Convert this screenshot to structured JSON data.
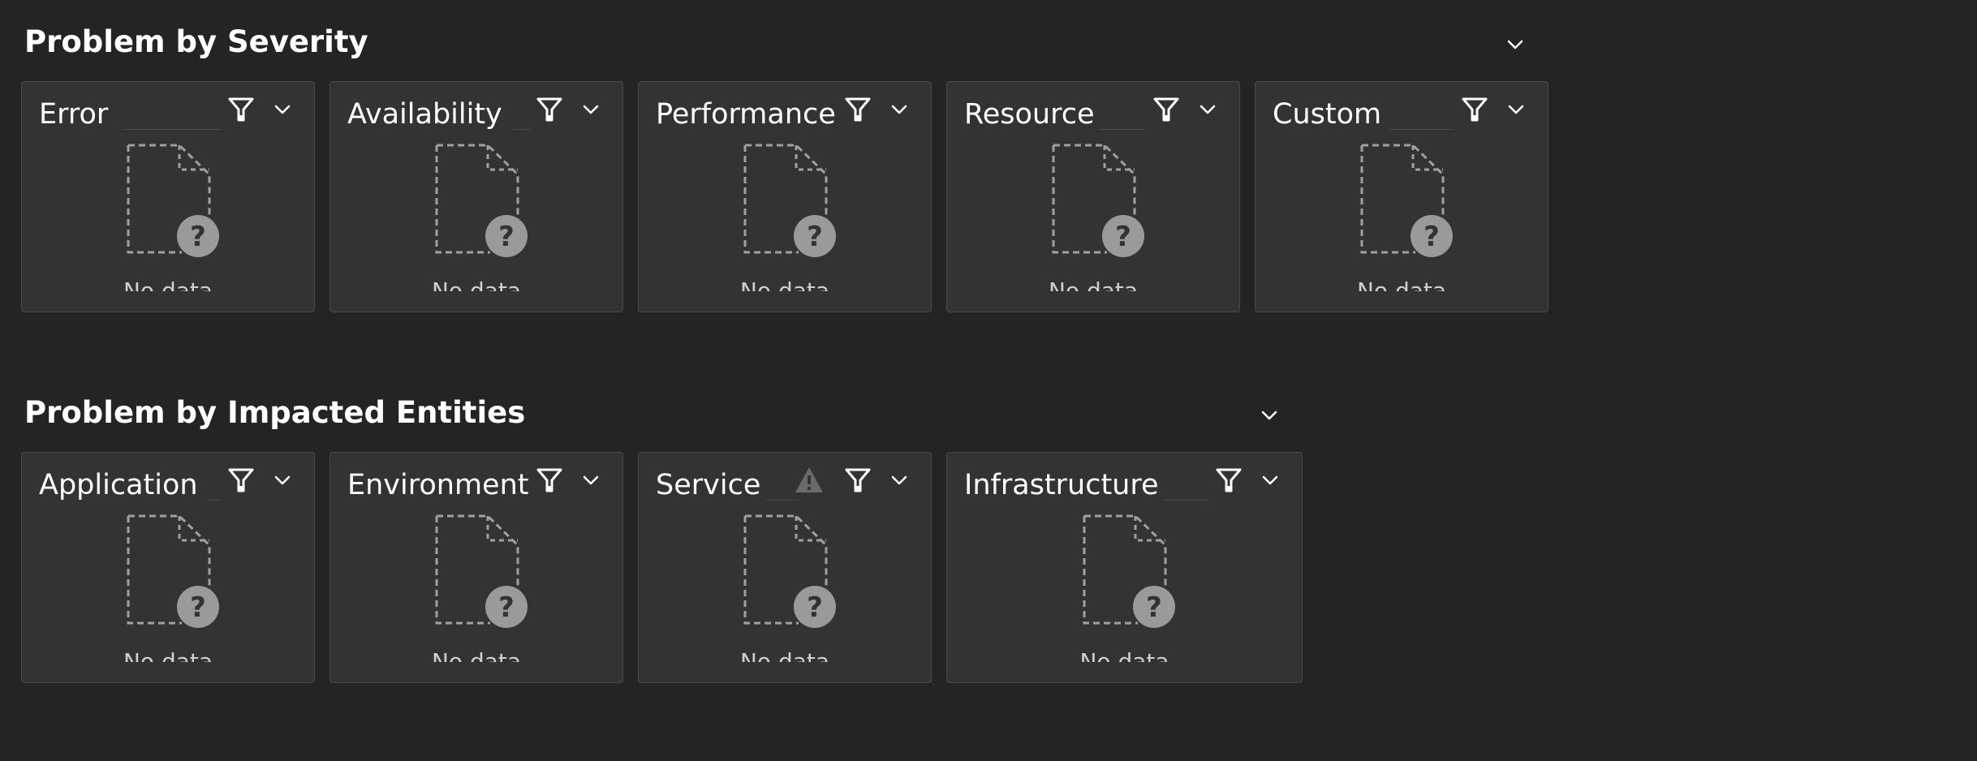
{
  "colors": {
    "background": "#242424",
    "tile_background": "#333333",
    "tile_border": "#4a4a4a",
    "icon_white": "#ffffff",
    "illustration_gray": "#a0a0a0",
    "warning_gray": "#6a6a6a"
  },
  "sections": [
    {
      "title": "Problem by Severity",
      "tiles": [
        {
          "title": "Error",
          "empty_text": "No data",
          "icons": [
            "filter-icon",
            "chevron-down-icon"
          ]
        },
        {
          "title": "Availability",
          "empty_text": "No data",
          "icons": [
            "filter-icon",
            "chevron-down-icon"
          ]
        },
        {
          "title": "Performance",
          "empty_text": "No data",
          "icons": [
            "filter-icon",
            "chevron-down-icon"
          ]
        },
        {
          "title": "Resource",
          "empty_text": "No data",
          "icons": [
            "filter-icon",
            "chevron-down-icon"
          ]
        },
        {
          "title": "Custom",
          "empty_text": "No data",
          "icons": [
            "filter-icon",
            "chevron-down-icon"
          ]
        }
      ]
    },
    {
      "title": "Problem by Impacted Entities",
      "tiles": [
        {
          "title": "Application",
          "empty_text": "No data",
          "icons": [
            "filter-icon",
            "chevron-down-icon"
          ]
        },
        {
          "title": "Environment",
          "empty_text": "No data",
          "icons": [
            "filter-icon",
            "chevron-down-icon"
          ]
        },
        {
          "title": "Service",
          "empty_text": "No data",
          "icons": [
            "warning-icon",
            "filter-icon",
            "chevron-down-icon"
          ]
        },
        {
          "title": "Infrastructure",
          "empty_text": "No data",
          "icons": [
            "filter-icon",
            "chevron-down-icon"
          ]
        }
      ]
    }
  ]
}
